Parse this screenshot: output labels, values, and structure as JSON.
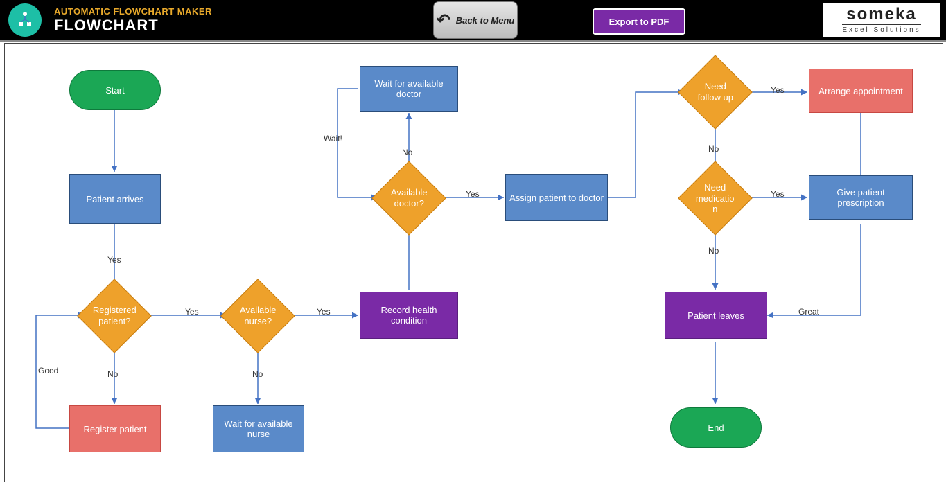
{
  "header": {
    "supertitle": "AUTOMATIC FLOWCHART MAKER",
    "title": "FLOWCHART",
    "back_button": "Back to Menu",
    "export_button": "Export to PDF",
    "brand_main": "someka",
    "brand_sub": "Excel Solutions"
  },
  "nodes": {
    "start": "Start",
    "patient_arrives": "Patient arrives",
    "registered_patient": "Registered patient?",
    "register_patient": "Register patient",
    "available_nurse": "Available nurse?",
    "wait_nurse": "Wait for available nurse",
    "record_health": "Record health condition",
    "available_doctor": "Available doctor?",
    "wait_doctor": "Wait for available doctor",
    "assign_patient": "Assign patient to doctor",
    "need_follow_up": "Need follow up",
    "arrange_appointment": "Arrange appointment",
    "need_medication": "Need medicatio n",
    "give_prescription": "Give patient prescription",
    "patient_leaves": "Patient leaves",
    "end": "End"
  },
  "labels": {
    "yes": "Yes",
    "no": "No",
    "wait": "Wait!",
    "good": "Good",
    "great": "Great"
  }
}
